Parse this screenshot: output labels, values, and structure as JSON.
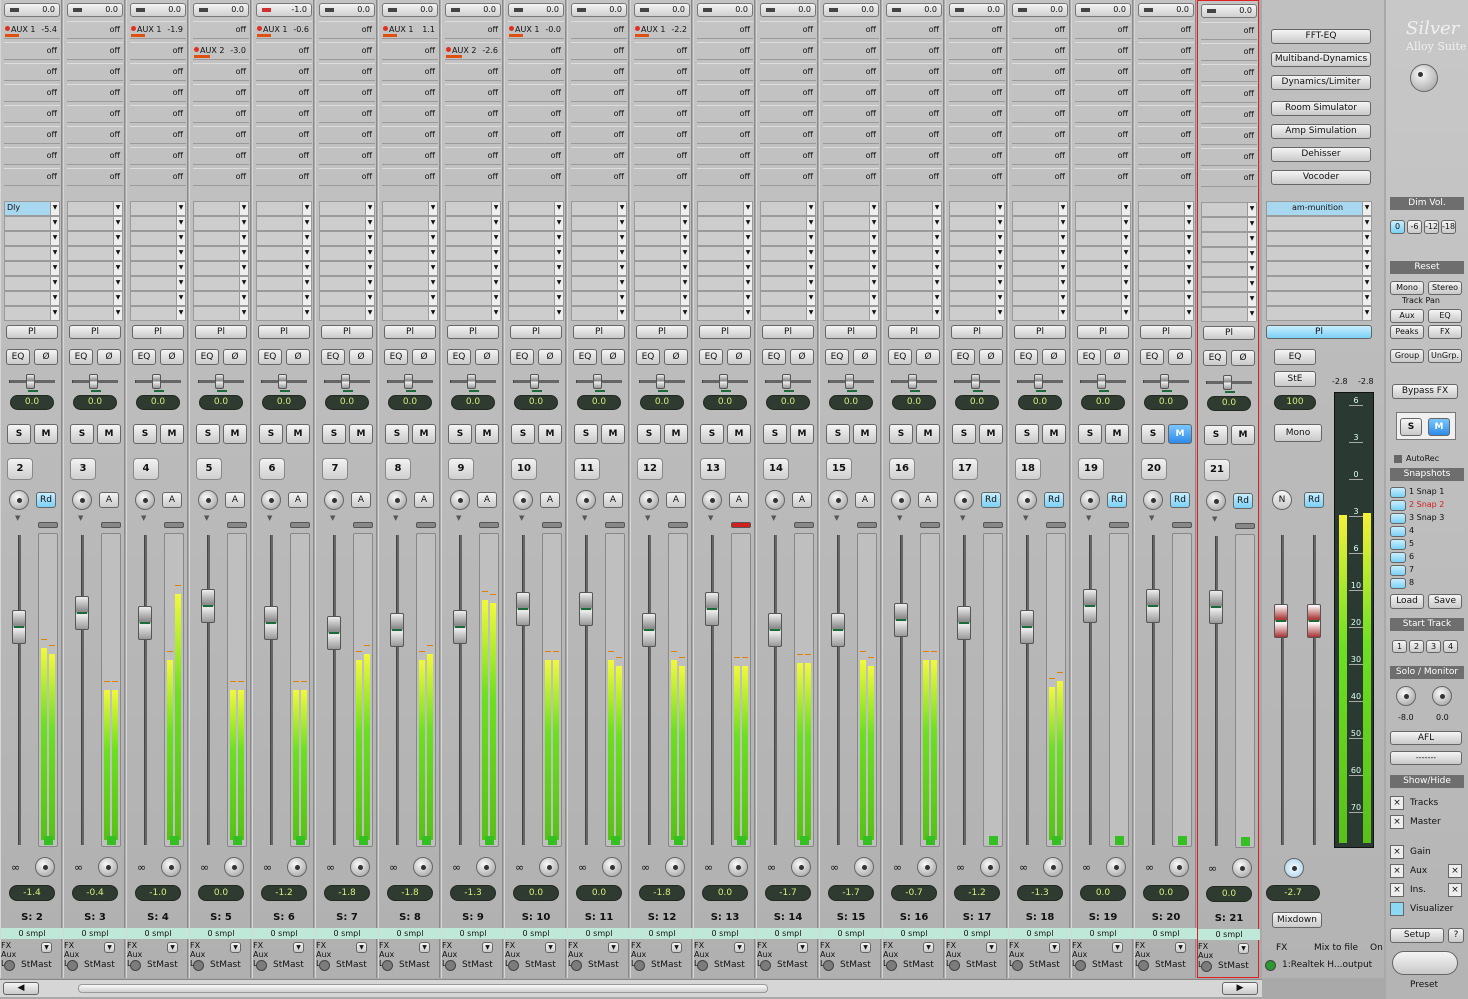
{
  "channels": [
    {
      "num": "2",
      "top": "0.0",
      "sends": [
        {
          "name": "AUX 1",
          "val": "-5.4"
        },
        {
          "val": "off"
        },
        {
          "val": "off"
        },
        {
          "val": "off"
        },
        {
          "val": "off"
        },
        {
          "val": "off"
        },
        {
          "val": "off"
        },
        {
          "val": "off"
        }
      ],
      "insert": "Dly",
      "pan": "0.0",
      "rd": "Rd",
      "vol": "-1.4",
      "s_label": "S: 2",
      "smpl": "0 smpl",
      "out": "StMast",
      "meter": [
        0.64,
        0.62
      ],
      "fader": 0.78
    },
    {
      "num": "3",
      "top": "0.0",
      "sends": [
        {
          "val": "off"
        },
        {
          "val": "off"
        },
        {
          "val": "off"
        },
        {
          "val": "off"
        },
        {
          "val": "off"
        },
        {
          "val": "off"
        },
        {
          "val": "off"
        },
        {
          "val": "off"
        }
      ],
      "insert": "",
      "pan": "0.0",
      "rd": "A",
      "vol": "-0.4",
      "s_label": "S: 3",
      "smpl": "0 smpl",
      "out": "StMast",
      "meter": [
        0.5,
        0.5
      ],
      "fader": 0.82
    },
    {
      "num": "4",
      "top": "0.0",
      "sends": [
        {
          "name": "AUX 1",
          "val": "-1.9"
        },
        {
          "val": "off"
        },
        {
          "val": "off"
        },
        {
          "val": "off"
        },
        {
          "val": "off"
        },
        {
          "val": "off"
        },
        {
          "val": "off"
        },
        {
          "val": "off"
        }
      ],
      "insert": "",
      "pan": "0.0",
      "rd": "A",
      "vol": "-1.0",
      "s_label": "S: 4",
      "smpl": "0 smpl",
      "out": "StMast",
      "meter": [
        0.6,
        0.82
      ],
      "fader": 0.79
    },
    {
      "num": "5",
      "top": "0.0",
      "sends": [
        {
          "val": "off"
        },
        {
          "name": "AUX 2",
          "val": "-3.0"
        },
        {
          "val": "off"
        },
        {
          "val": "off"
        },
        {
          "val": "off"
        },
        {
          "val": "off"
        },
        {
          "val": "off"
        },
        {
          "val": "off"
        }
      ],
      "insert": "",
      "pan": "0.0",
      "rd": "A",
      "vol": "0.0",
      "s_label": "S: 5",
      "smpl": "0 smpl",
      "out": "StMast",
      "meter": [
        0.5,
        0.5
      ],
      "fader": 0.84
    },
    {
      "num": "6",
      "top": "-1.0",
      "sends": [
        {
          "name": "AUX 1",
          "val": "-0.6"
        },
        {
          "val": "off"
        },
        {
          "val": "off"
        },
        {
          "val": "off"
        },
        {
          "val": "off"
        },
        {
          "val": "off"
        },
        {
          "val": "off"
        },
        {
          "val": "off"
        }
      ],
      "insert": "",
      "pan": "0.0",
      "rd": "A",
      "vol": "-1.2",
      "s_label": "S: 6",
      "smpl": "0 smpl",
      "out": "StMast",
      "meter": [
        0.5,
        0.5
      ],
      "fader": 0.79
    },
    {
      "num": "7",
      "top": "0.0",
      "sends": [
        {
          "val": "off"
        },
        {
          "val": "off"
        },
        {
          "val": "off"
        },
        {
          "val": "off"
        },
        {
          "val": "off"
        },
        {
          "val": "off"
        },
        {
          "val": "off"
        },
        {
          "val": "off"
        }
      ],
      "insert": "",
      "pan": "0.0",
      "rd": "A",
      "vol": "-1.8",
      "s_label": "S: 7",
      "smpl": "0 smpl",
      "out": "StMast",
      "meter": [
        0.6,
        0.62
      ],
      "fader": 0.76
    },
    {
      "num": "8",
      "top": "0.0",
      "sends": [
        {
          "name": "AUX 1",
          "val": "1.1"
        },
        {
          "val": "off"
        },
        {
          "val": "off"
        },
        {
          "val": "off"
        },
        {
          "val": "off"
        },
        {
          "val": "off"
        },
        {
          "val": "off"
        },
        {
          "val": "off"
        }
      ],
      "insert": "",
      "pan": "0.0",
      "rd": "A",
      "vol": "-1.8",
      "s_label": "S: 8",
      "smpl": "0 smpl",
      "out": "StMast",
      "meter": [
        0.6,
        0.62
      ],
      "fader": 0.77
    },
    {
      "num": "9",
      "top": "0.0",
      "sends": [
        {
          "val": "off"
        },
        {
          "name": "AUX 2",
          "val": "-2.6"
        },
        {
          "val": "off"
        },
        {
          "val": "off"
        },
        {
          "val": "off"
        },
        {
          "val": "off"
        },
        {
          "val": "off"
        },
        {
          "val": "off"
        }
      ],
      "insert": "",
      "pan": "0.0",
      "rd": "A",
      "vol": "-1.3",
      "s_label": "S: 9",
      "smpl": "0 smpl",
      "out": "StMast",
      "meter": [
        0.8,
        0.79
      ],
      "fader": 0.78
    },
    {
      "num": "10",
      "top": "0.0",
      "sends": [
        {
          "name": "AUX 1",
          "val": "-0.0"
        },
        {
          "val": "off"
        },
        {
          "val": "off"
        },
        {
          "val": "off"
        },
        {
          "val": "off"
        },
        {
          "val": "off"
        },
        {
          "val": "off"
        },
        {
          "val": "off"
        }
      ],
      "insert": "",
      "pan": "0.0",
      "rd": "A",
      "vol": "0.0",
      "s_label": "S: 10",
      "smpl": "0 smpl",
      "out": "StMast",
      "meter": [
        0.6,
        0.6
      ],
      "fader": 0.83
    },
    {
      "num": "11",
      "top": "0.0",
      "sends": [
        {
          "val": "off"
        },
        {
          "val": "off"
        },
        {
          "val": "off"
        },
        {
          "val": "off"
        },
        {
          "val": "off"
        },
        {
          "val": "off"
        },
        {
          "val": "off"
        },
        {
          "val": "off"
        }
      ],
      "insert": "",
      "pan": "0.0",
      "rd": "A",
      "vol": "0.0",
      "s_label": "S: 11",
      "smpl": "0 smpl",
      "out": "StMast",
      "meter": [
        0.6,
        0.58
      ],
      "fader": 0.83
    },
    {
      "num": "12",
      "top": "0.0",
      "sends": [
        {
          "name": "AUX 1",
          "val": "-2.2"
        },
        {
          "val": "off"
        },
        {
          "val": "off"
        },
        {
          "val": "off"
        },
        {
          "val": "off"
        },
        {
          "val": "off"
        },
        {
          "val": "off"
        },
        {
          "val": "off"
        }
      ],
      "insert": "",
      "pan": "0.0",
      "rd": "A",
      "vol": "-1.8",
      "s_label": "S: 12",
      "smpl": "0 smpl",
      "out": "StMast",
      "meter": [
        0.6,
        0.58
      ],
      "fader": 0.77
    },
    {
      "num": "13",
      "top": "0.0",
      "sends": [
        {
          "val": "off"
        },
        {
          "val": "off"
        },
        {
          "val": "off"
        },
        {
          "val": "off"
        },
        {
          "val": "off"
        },
        {
          "val": "off"
        },
        {
          "val": "off"
        },
        {
          "val": "off"
        }
      ],
      "insert": "",
      "pan": "0.0",
      "rd": "A",
      "vol": "0.0",
      "s_label": "S: 13",
      "smpl": "0 smpl",
      "out": "StMast",
      "meter": [
        0.58,
        0.58
      ],
      "fader": 0.83
    },
    {
      "num": "14",
      "top": "0.0",
      "sends": [
        {
          "val": "off"
        },
        {
          "val": "off"
        },
        {
          "val": "off"
        },
        {
          "val": "off"
        },
        {
          "val": "off"
        },
        {
          "val": "off"
        },
        {
          "val": "off"
        },
        {
          "val": "off"
        }
      ],
      "insert": "",
      "pan": "0.0",
      "rd": "A",
      "vol": "-1.7",
      "s_label": "S: 14",
      "smpl": "0 smpl",
      "out": "StMast",
      "meter": [
        0.59,
        0.59
      ],
      "fader": 0.77
    },
    {
      "num": "15",
      "top": "0.0",
      "sends": [
        {
          "val": "off"
        },
        {
          "val": "off"
        },
        {
          "val": "off"
        },
        {
          "val": "off"
        },
        {
          "val": "off"
        },
        {
          "val": "off"
        },
        {
          "val": "off"
        },
        {
          "val": "off"
        }
      ],
      "insert": "",
      "pan": "0.0",
      "rd": "A",
      "vol": "-1.7",
      "s_label": "S: 15",
      "smpl": "0 smpl",
      "out": "StMast",
      "meter": [
        0.6,
        0.58
      ],
      "fader": 0.77
    },
    {
      "num": "16",
      "top": "0.0",
      "sends": [
        {
          "val": "off"
        },
        {
          "val": "off"
        },
        {
          "val": "off"
        },
        {
          "val": "off"
        },
        {
          "val": "off"
        },
        {
          "val": "off"
        },
        {
          "val": "off"
        },
        {
          "val": "off"
        }
      ],
      "insert": "",
      "pan": "0.0",
      "rd": "A",
      "vol": "-0.7",
      "s_label": "S: 16",
      "smpl": "0 smpl",
      "out": "StMast",
      "meter": [
        0.6,
        0.6
      ],
      "fader": 0.8
    },
    {
      "num": "17",
      "top": "0.0",
      "sends": [
        {
          "val": "off"
        },
        {
          "val": "off"
        },
        {
          "val": "off"
        },
        {
          "val": "off"
        },
        {
          "val": "off"
        },
        {
          "val": "off"
        },
        {
          "val": "off"
        },
        {
          "val": "off"
        }
      ],
      "insert": "",
      "pan": "0.0",
      "rd": "Rd",
      "vol": "-1.2",
      "s_label": "S: 17",
      "smpl": "0 smpl",
      "out": "StMast",
      "meter": [
        0.0,
        0.0
      ],
      "fader": 0.79
    },
    {
      "num": "18",
      "top": "0.0",
      "sends": [
        {
          "val": "off"
        },
        {
          "val": "off"
        },
        {
          "val": "off"
        },
        {
          "val": "off"
        },
        {
          "val": "off"
        },
        {
          "val": "off"
        },
        {
          "val": "off"
        },
        {
          "val": "off"
        }
      ],
      "insert": "",
      "pan": "0.0",
      "rd": "Rd",
      "vol": "-1.3",
      "s_label": "S: 18",
      "smpl": "0 smpl",
      "out": "StMast",
      "meter": [
        0.51,
        0.53
      ],
      "fader": 0.78
    },
    {
      "num": "19",
      "top": "0.0",
      "sends": [
        {
          "val": "off"
        },
        {
          "val": "off"
        },
        {
          "val": "off"
        },
        {
          "val": "off"
        },
        {
          "val": "off"
        },
        {
          "val": "off"
        },
        {
          "val": "off"
        },
        {
          "val": "off"
        }
      ],
      "insert": "",
      "pan": "0.0",
      "rd": "Rd",
      "vol": "0.0",
      "s_label": "S: 19",
      "smpl": "0 smpl",
      "out": "StMast",
      "meter": [
        0.0,
        0.0
      ],
      "fader": 0.84
    },
    {
      "num": "20",
      "top": "0.0",
      "sends": [
        {
          "val": "off"
        },
        {
          "val": "off"
        },
        {
          "val": "off"
        },
        {
          "val": "off"
        },
        {
          "val": "off"
        },
        {
          "val": "off"
        },
        {
          "val": "off"
        },
        {
          "val": "off"
        }
      ],
      "insert": "",
      "pan": "0.0",
      "rd": "Rd",
      "vol": "0.0",
      "s_label": "S: 20",
      "smpl": "0 smpl",
      "out": "StMast",
      "meter": [
        0.0,
        0.0
      ],
      "fader": 0.84
    },
    {
      "num": "21",
      "top": "0.0",
      "sends": [
        {
          "val": "off"
        },
        {
          "val": "off"
        },
        {
          "val": "off"
        },
        {
          "val": "off"
        },
        {
          "val": "off"
        },
        {
          "val": "off"
        },
        {
          "val": "off"
        },
        {
          "val": "off"
        }
      ],
      "insert": "",
      "pan": "0.0",
      "rd": "Rd",
      "vol": "0.0",
      "s_label": "S: 21",
      "smpl": "0 smpl",
      "out": "StMast",
      "meter": [
        0.0,
        0.0
      ],
      "fader": 0.84
    }
  ],
  "strip_common": {
    "pl": "Pl",
    "eq": "EQ",
    "phase": "Ø",
    "s": "S",
    "m": "M",
    "link": "∞",
    "fx": "FX",
    "aux": "Aux",
    "l": "L"
  },
  "master": {
    "fx_buttons": [
      "FFT-EQ",
      "Multiband-Dynamics",
      "Dynamics/Limiter",
      "Room Simulator",
      "Amp Simulation",
      "Dehisser",
      "Vocoder"
    ],
    "insert": "am-munition",
    "pl": "Pl",
    "eq": "EQ",
    "ste": "StE",
    "width": "100",
    "mono": "Mono",
    "n": "N",
    "rd": "Rd",
    "peak_l": "-2.8",
    "peak_r": "-2.8",
    "vol_l": "-2.7",
    "vol_r": "-2.7",
    "mixdown": "Mixdown",
    "fx": "FX",
    "mix_to_file": "Mix to file",
    "on": "On",
    "output": "1:Realtek H...output",
    "scale": [
      "6",
      "3",
      "0",
      "3",
      "6",
      "10",
      "20",
      "30",
      "40",
      "50",
      "60",
      "70"
    ]
  },
  "panel": {
    "title": "Silver",
    "subtitle": "Alloy Suite",
    "dim_vol": "Dim Vol.",
    "dim_options": [
      "0",
      "-6",
      "-12",
      "-18"
    ],
    "reset": "Reset",
    "mono": "Mono",
    "stereo": "Stereo",
    "track_pan": "Track Pan",
    "aux": "Aux",
    "eq": "EQ",
    "peaks": "Peaks",
    "fx": "FX",
    "group": "Group",
    "ungrp": "UnGrp.",
    "bypass_fx": "Bypass FX",
    "s": "S",
    "m": "M",
    "autorec": "AutoRec",
    "snapshots": "Snapshots",
    "snaps": [
      "1 Snap 1",
      "2 Snap 2",
      "3 Snap 3",
      "4",
      "5",
      "6",
      "7",
      "8"
    ],
    "load": "Load",
    "save": "Save",
    "start_track": "Start Track",
    "start_opts": [
      "1",
      "2",
      "3",
      "4"
    ],
    "solo_monitor": "Solo / Monitor",
    "solo_l": "-8.0",
    "solo_r": "0.0",
    "afl": "AFL",
    "afl_select": "-------",
    "show_hide": "Show/Hide",
    "tracks": "Tracks",
    "master_lbl": "Master",
    "gain": "Gain",
    "aux_lbl": "Aux",
    "ins": "Ins.",
    "visualizer": "Visualizer",
    "setup": "Setup",
    "help": "?",
    "preset": "Preset"
  }
}
